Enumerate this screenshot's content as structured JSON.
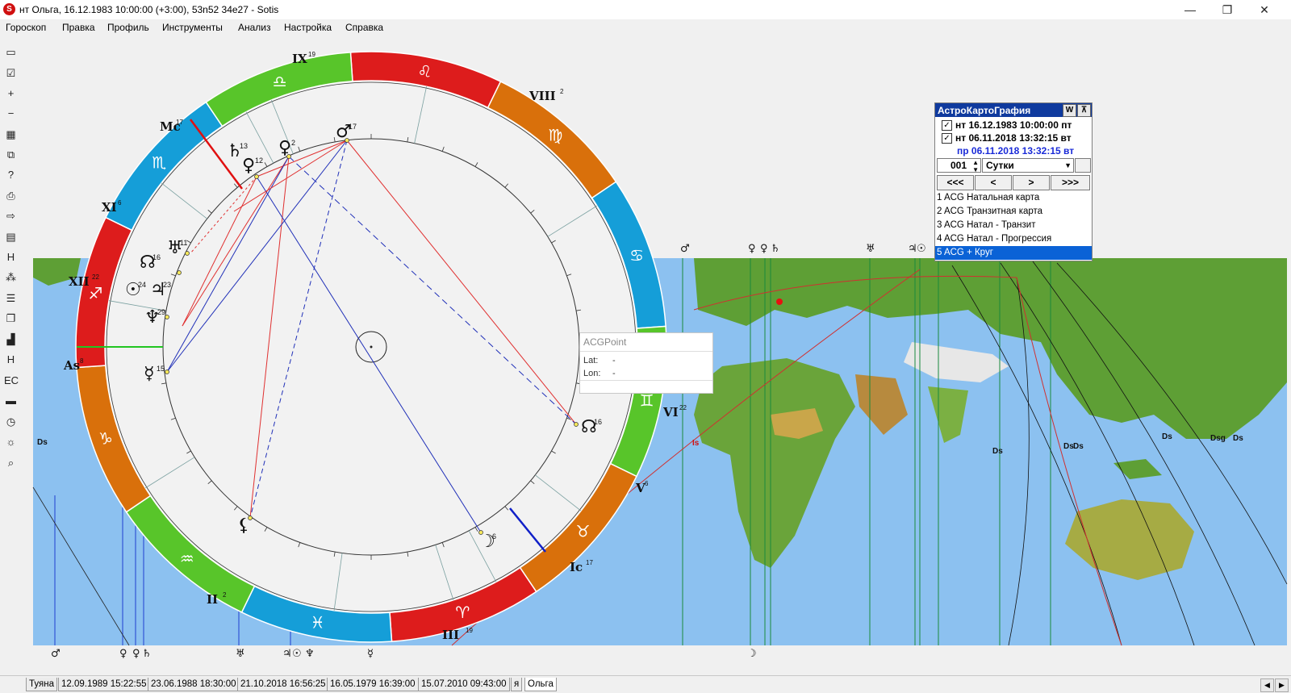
{
  "window": {
    "title": "нт Ольга, 16.12.1983 10:00:00 (+3:00), 53n52 34e27 - Sotis",
    "minimize": "—",
    "maximize": "❐",
    "close": "✕"
  },
  "menu": [
    "Гороскоп",
    "Правка",
    "Профиль",
    "Инструменты",
    "Анализ",
    "Настройка",
    "Справка"
  ],
  "toolbar_icons": [
    "new-icon",
    "check-document-icon",
    "add-icon",
    "remove-icon",
    "image-icon",
    "copy-icon",
    "help-icon",
    "print-icon",
    "export-icon",
    "table-icon",
    "house-h-icon",
    "grid-icon",
    "list-icon",
    "layers-icon",
    "chart-icon",
    "h-italic-icon",
    "ec-icon",
    "folder-icon",
    "clock-icon",
    "sun-icon",
    "zoom-icon"
  ],
  "toolbar_glyphs": [
    "▭",
    "☑",
    "+",
    "−",
    "▦",
    "⧉",
    "?",
    "⎙",
    "⇨",
    "▤",
    "H",
    "⁂",
    "☰",
    "❐",
    "▟",
    "H",
    "EC",
    "▬",
    "◷",
    "☼",
    "⌕"
  ],
  "houses": {
    "IX": "IX",
    "IX_deg": "19",
    "VIII": "VIII",
    "VIII_deg": "2",
    "XI": "XI",
    "XI_deg": "6",
    "XII": "XII",
    "XII_deg": "22",
    "As": "As",
    "As_deg": "8",
    "II": "II",
    "II_deg": "2",
    "III": "III",
    "III_deg": "19",
    "V": "V",
    "V_deg": "6",
    "VI": "VI",
    "VI_deg": "22",
    "Mc": "Mc",
    "Mc_deg": "17",
    "Ic": "Ic",
    "Ic_deg": "17"
  },
  "zodiac": [
    "♌",
    "♍",
    "♋",
    "♊",
    "♉",
    "♈",
    "♓",
    "♒",
    "♑",
    "♐",
    "♏",
    "♎"
  ],
  "planets": [
    {
      "glyph": "♄",
      "deg": "13"
    },
    {
      "glyph": "♀",
      "deg": "12"
    },
    {
      "glyph": "♀",
      "deg": "2"
    },
    {
      "glyph": "♂",
      "deg": "17"
    },
    {
      "glyph": "♅",
      "deg": "11"
    },
    {
      "glyph": "☊",
      "deg": "16"
    },
    {
      "glyph": "☉",
      "deg": "24"
    },
    {
      "glyph": "♃",
      "deg": "23"
    },
    {
      "glyph": "♆",
      "deg": "29"
    },
    {
      "glyph": "☿",
      "deg": "15"
    },
    {
      "glyph": "☊",
      "deg": "16"
    },
    {
      "glyph": "☽",
      "deg": "6"
    },
    {
      "glyph": "⚸",
      "deg": ""
    }
  ],
  "map_top_glyphs": [
    "♂",
    "♀",
    "♀",
    "♄",
    "♅",
    "♃",
    "☉"
  ],
  "map_bottom_glyphs": [
    "♂",
    "♀",
    "♀",
    "♄",
    "♅",
    "♃",
    "☉",
    "♆",
    "☿",
    "☽"
  ],
  "map_labels": {
    "ds": "Ds",
    "dsg": "Dsg",
    "is": "Is"
  },
  "acg": {
    "title": "АстроКартоГрафия",
    "btn_w": "W",
    "btn_pin": "⊼",
    "date1": "нт 16.12.1983 10:00:00 пт",
    "date2": "нт 06.11.2018 13:32:15 вт",
    "date3": "пр 06.11.2018 13:32:15 вт",
    "step": "001",
    "unit": "Сутки",
    "nav": [
      "<<<",
      "<",
      ">",
      ">>>"
    ],
    "items": [
      "1 ACG Натальная карта",
      "2 ACG Транзитная карта",
      "3 ACG Натал - Транзит",
      "4 ACG Натал - Прогрессия",
      "5 ACG + Круг"
    ],
    "selected_index": 4
  },
  "tooltip": {
    "title": "ACGPoint",
    "lat_label": "Lat:",
    "lat_val": "-",
    "lon_label": "Lon:",
    "lon_val": "-"
  },
  "tabs": [
    "Туяна",
    "12.09.1989 15:22:55",
    "23.06.1988 18:30:00",
    "21.10.2018 16:56:25",
    "16.05.1979 16:39:00",
    "15.07.2010 09:43:00",
    "я",
    "Ольга"
  ],
  "active_tab": "Ольга",
  "colors": {
    "fire": "#dd1c1c",
    "earth": "#d9700b",
    "air": "#58c52a",
    "water": "#159ed8",
    "sea": "#8cc1f0",
    "land": "#4f9a32"
  }
}
